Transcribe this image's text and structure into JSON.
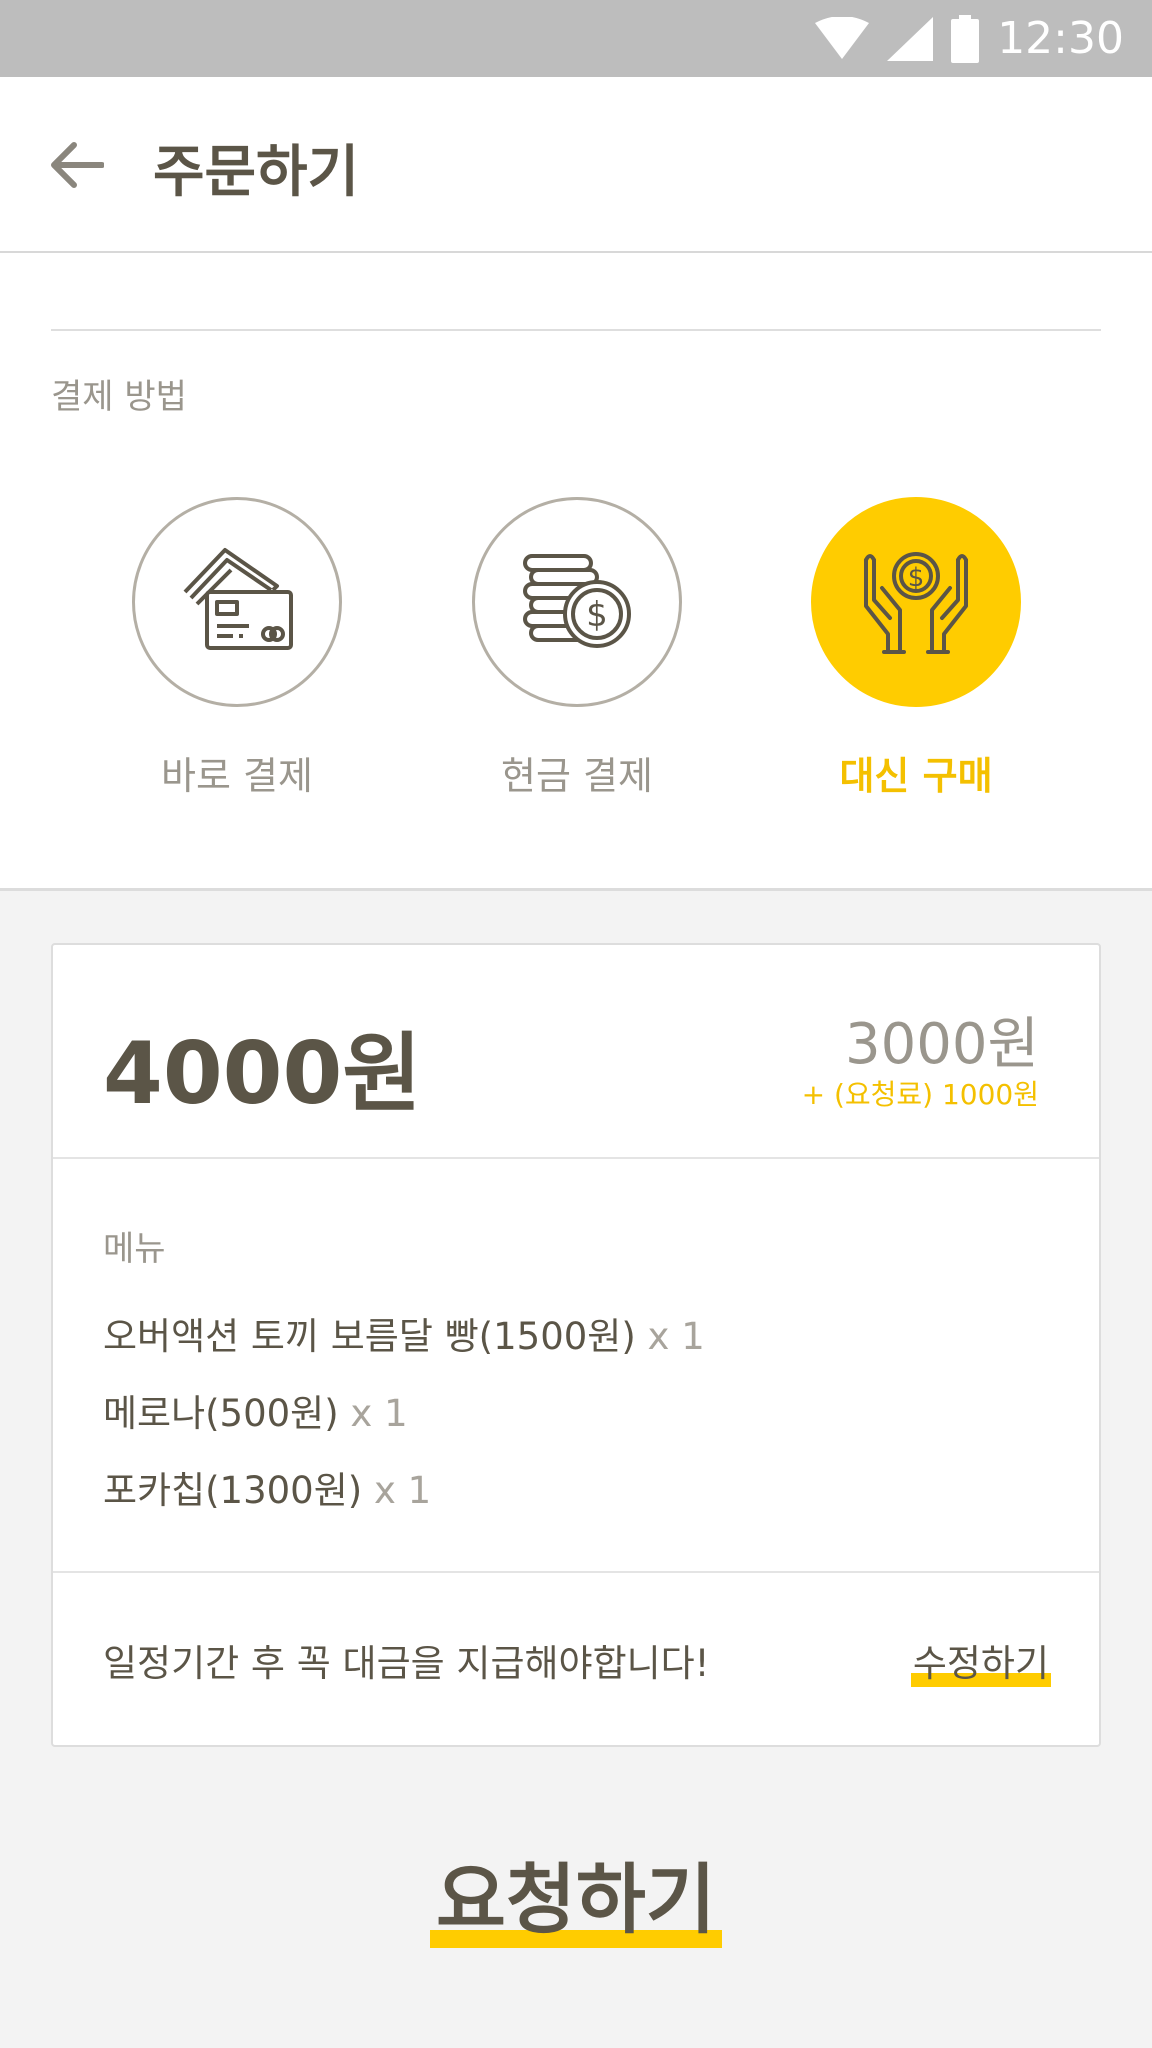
{
  "status_bar": {
    "time": "12:30",
    "icons": [
      "wifi-icon",
      "cell-signal-icon",
      "battery-icon"
    ]
  },
  "header": {
    "title": "주문하기",
    "back_icon": "arrow-left-icon"
  },
  "payment": {
    "label": "결제 방법",
    "methods": [
      {
        "label": "바로 결제",
        "icon": "credit-cards-icon",
        "selected": false
      },
      {
        "label": "현금 결제",
        "icon": "coin-stack-icon",
        "selected": false
      },
      {
        "label": "대신 구매",
        "icon": "hands-holding-coin-icon",
        "selected": true
      }
    ]
  },
  "order": {
    "total": "4000원",
    "base_price": "3000원",
    "fee_note": "+ (요청료) 1000원",
    "menu_title": "메뉴",
    "items": [
      {
        "name": "오버액션 토끼 보름달 빵(1500원)",
        "qty": "x 1"
      },
      {
        "name": "메로나(500원)",
        "qty": "x 1"
      },
      {
        "name": "포카칩(1300원)",
        "qty": "x 1"
      }
    ],
    "notice": "일정기간 후 꼭 대금을 지급해야합니다!",
    "edit_label": "수정하기"
  },
  "request_label": "요청하기",
  "colors": {
    "accent": "#ffcc00",
    "text": "#5b5547",
    "muted": "#9a968d",
    "status_bar": "#bdbdbd"
  }
}
